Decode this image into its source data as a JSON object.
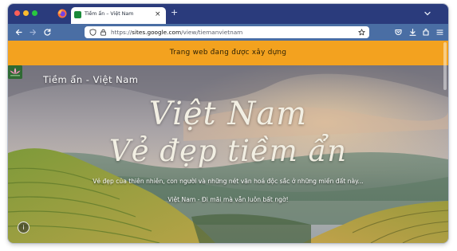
{
  "browser": {
    "tab": {
      "title": "Tiềm ẩn – Việt Nam",
      "close_glyph": "×"
    },
    "new_tab_glyph": "+",
    "url": {
      "scheme": "https://",
      "host": "sites.google.com",
      "path": "/view/tiemanvietnam"
    }
  },
  "page": {
    "banner": "Trang web đang được xây dựng",
    "site_name": "Tiềm ẩn - Việt Nam",
    "hero": {
      "title_line1": "Việt Nam",
      "title_line2": "Vẻ đẹp tiềm ẩn",
      "subtitle": "Vẻ đẹp của thiên nhiên, con người và những nét văn hoá độc sắc ở những miền đất này...",
      "tagline": "Việt Nam - Đi mãi mà vẫn luôn bất ngờ!"
    },
    "info_glyph": "i"
  },
  "colors": {
    "tab_strip": "#2a3b7c",
    "nav_bar": "#4a6ea4",
    "banner": "#f3a21f",
    "favicon": "#1b8a3a"
  },
  "icons": [
    "firefox-icon",
    "tab-favicon",
    "tab-close-icon",
    "new-tab-icon",
    "list-all-tabs-icon",
    "back-arrow-icon",
    "forward-arrow-icon",
    "reload-icon",
    "shield-icon",
    "lock-icon",
    "bookmark-star-icon",
    "pocket-icon",
    "download-icon",
    "extensions-icon",
    "hamburger-menu-icon",
    "lotus-logo-icon",
    "info-icon"
  ]
}
